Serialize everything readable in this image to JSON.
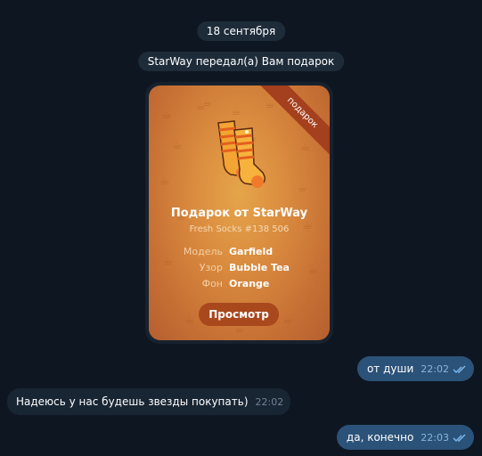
{
  "chat": {
    "date_label": "18 сентября",
    "service_message": "StarWay передал(а) Вам подарок"
  },
  "gift": {
    "ribbon_label": "подарок",
    "title": "Подарок от StarWay",
    "subtitle": "Fresh Socks #138 506",
    "attributes": [
      {
        "key": "Модель",
        "value": "Garfield"
      },
      {
        "key": "Узор",
        "value": "Bubble Tea"
      },
      {
        "key": "Фон",
        "value": "Orange"
      }
    ],
    "button_label": "Просмотр",
    "item_icon": "socks-icon",
    "pattern_icon": "bubble-tea-icon"
  },
  "messages": [
    {
      "direction": "out",
      "text": "от души",
      "time": "22:02",
      "status": "read"
    },
    {
      "direction": "in",
      "text": "Надеюсь у нас будешь звезды покупать)",
      "time": "22:02"
    },
    {
      "direction": "out",
      "text": "да, конечно",
      "time": "22:03",
      "status": "read"
    }
  ],
  "colors": {
    "background": "#0e1621",
    "outgoing_bubble": "#2b5278",
    "incoming_bubble": "#182533",
    "gift_accent": "#d98a3e",
    "button": "#a9471d"
  }
}
